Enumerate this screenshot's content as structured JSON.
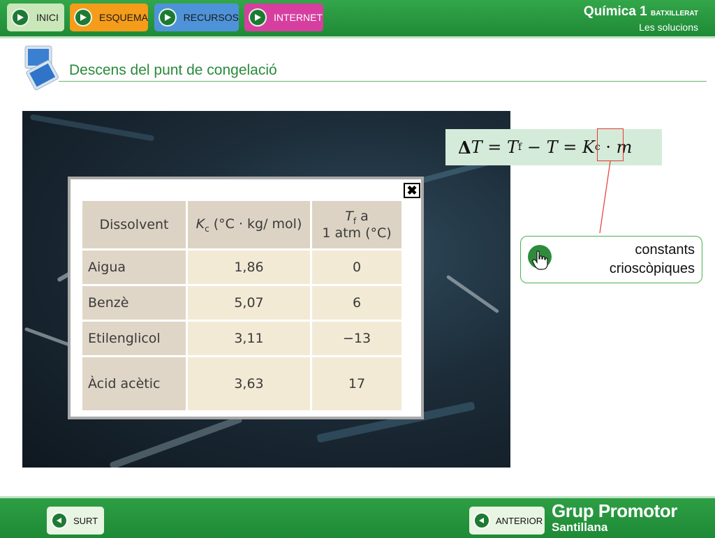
{
  "nav": {
    "inici": "INICI",
    "esquema": "ESQUEMA",
    "recursos": "RECURSOS",
    "internet": "INTERNET"
  },
  "brand": {
    "title": "Química 1",
    "level": "BATXILLERAT",
    "subtitle": "Les solucions"
  },
  "page": {
    "title": "Descens del punt de congelació"
  },
  "table": {
    "headers": {
      "solvent": "Dissolvent",
      "kc_symbol": "K",
      "kc_sub": "c",
      "kc_unit": " (°C · kg/ mol)",
      "tf_symbol": "T",
      "tf_sub": "f",
      "tf_line1_rest": " a",
      "tf_line2": "1 atm (°C)"
    },
    "rows": [
      {
        "solvent": "Aigua",
        "kc": "1,86",
        "tf": "0"
      },
      {
        "solvent": "Benzè",
        "kc": "5,07",
        "tf": "6"
      },
      {
        "solvent": "Etilenglicol",
        "kc": "3,11",
        "tf": "−13"
      },
      {
        "solvent": "Àcid acètic",
        "kc": "3,63",
        "tf": "17"
      }
    ],
    "close_symbol": "✖"
  },
  "formula": {
    "delta": "Δ",
    "T1": "T",
    "eq1": " = ",
    "Tf": "T",
    "Tf_sub": "f",
    "minus": " − ",
    "T2": "T",
    "eq2": " = ",
    "K": "K",
    "K_sub": "c",
    "dot": " · ",
    "m": "m"
  },
  "callout": {
    "line1": "constants",
    "line2": "crioscòpiques"
  },
  "bottom": {
    "surt": "SURT",
    "anterior": "ANTERIOR",
    "logo_line1": "Grup Promotor",
    "logo_line2": "Santillana"
  },
  "colors": {
    "header_green": "#1f8a36",
    "title_green": "#2a8a3a",
    "esquema": "#f59c1a",
    "recursos": "#4e93d9",
    "internet": "#d63f9f",
    "formula_bg": "#d5ebd9",
    "highlight_red": "#e53935"
  },
  "icons": {
    "nav_play": "play-icon",
    "back": "back-arrow-icon",
    "close": "close-icon",
    "hand": "hand-pointer-icon",
    "title": "screens-icon"
  }
}
